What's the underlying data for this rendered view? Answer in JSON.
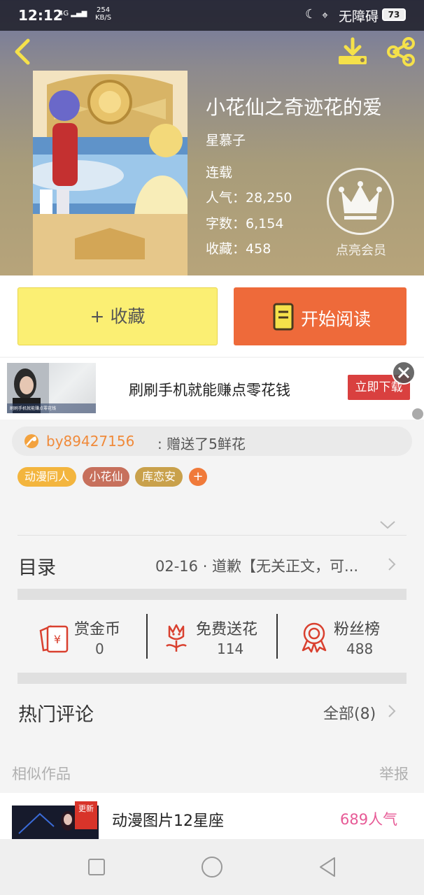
{
  "status_bar": {
    "time": "12:12",
    "network": "4G",
    "speed_value": "254",
    "speed_unit": "KB/S",
    "accessibility": "无障碍",
    "battery": "73"
  },
  "book": {
    "title": "小花仙之奇迹花的爱",
    "author": "星慕子",
    "status": "连载",
    "stats": [
      {
        "key": "人气：",
        "value": "28,250"
      },
      {
        "key": "字数：",
        "value": "6,154"
      },
      {
        "key": "收藏：",
        "value": "458"
      }
    ],
    "vip_label": "点亮会员"
  },
  "actions": {
    "collect_label": "+ 收藏",
    "read_label": "开始阅读"
  },
  "ad": {
    "text": "刷刷手机就能赚点零花钱",
    "cta": "立即下载",
    "thumb_caption": "刷刷手机就能赚点零花钱"
  },
  "gift": {
    "user": "by89427156",
    "message": ": 赠送了5鲜花"
  },
  "tags": [
    {
      "label": "动漫同人",
      "color": "#f3b53e"
    },
    {
      "label": "小花仙",
      "color": "#c7705c"
    },
    {
      "label": "库恋安",
      "color": "#c9a14b"
    }
  ],
  "tag_add_label": "+",
  "toc": {
    "label": "目录",
    "latest": "02-16 · 道歉【无关正文，可..."
  },
  "stats": [
    {
      "label": "赏金币",
      "value": "0"
    },
    {
      "label": "免费送花",
      "value": "114"
    },
    {
      "label": "粉丝榜",
      "value": "488"
    }
  ],
  "comments": {
    "title": "热门评论",
    "all_label": "全部(8)"
  },
  "similar": {
    "title": "相似作品",
    "report_label": "举报",
    "items": [
      {
        "badge": "更新",
        "name": "动漫图片12星座",
        "popularity": "689人气"
      }
    ]
  },
  "colors": {
    "accent": "#ee6a3a",
    "collect": "#fbef73",
    "stat_icon": "#d9402f",
    "popularity": "#e75a96"
  }
}
